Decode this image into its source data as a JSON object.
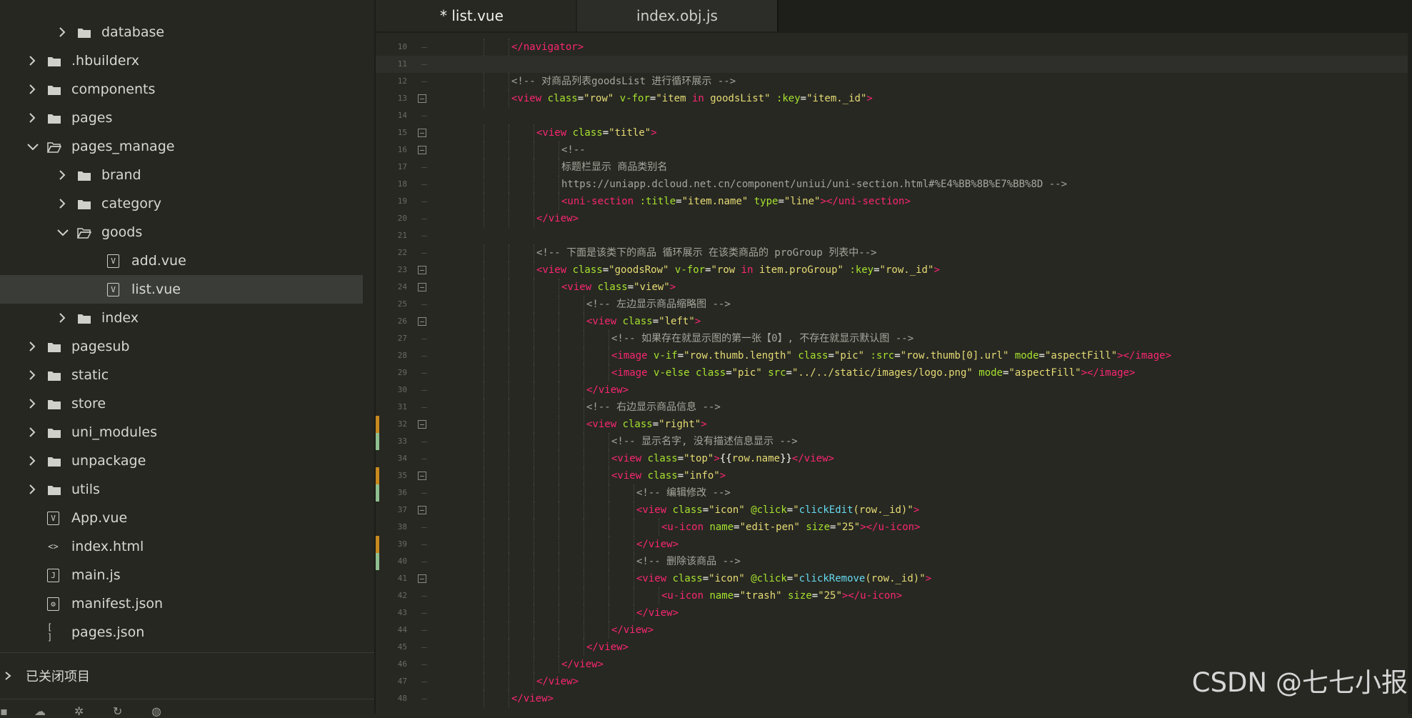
{
  "sidebar": {
    "items": [
      {
        "label": "database",
        "kind": "folder",
        "state": "collapsed",
        "depth": 1
      },
      {
        "label": ".hbuilderx",
        "kind": "folder",
        "state": "collapsed",
        "depth": 0
      },
      {
        "label": "components",
        "kind": "folder",
        "state": "collapsed",
        "depth": 0
      },
      {
        "label": "pages",
        "kind": "folder",
        "state": "collapsed",
        "depth": 0
      },
      {
        "label": "pages_manage",
        "kind": "folder",
        "state": "expanded",
        "depth": 0
      },
      {
        "label": "brand",
        "kind": "folder",
        "state": "collapsed",
        "depth": 1
      },
      {
        "label": "category",
        "kind": "folder",
        "state": "collapsed",
        "depth": 1
      },
      {
        "label": "goods",
        "kind": "folder",
        "state": "expanded",
        "depth": 1
      },
      {
        "label": "add.vue",
        "kind": "vue",
        "depth": 2
      },
      {
        "label": "list.vue",
        "kind": "vue",
        "depth": 2,
        "selected": true
      },
      {
        "label": "index",
        "kind": "folder",
        "state": "collapsed",
        "depth": 1
      },
      {
        "label": "pagesub",
        "kind": "folder",
        "state": "collapsed",
        "depth": 0
      },
      {
        "label": "static",
        "kind": "folder",
        "state": "collapsed",
        "depth": 0
      },
      {
        "label": "store",
        "kind": "folder",
        "state": "collapsed",
        "depth": 0
      },
      {
        "label": "uni_modules",
        "kind": "folder",
        "state": "collapsed",
        "depth": 0
      },
      {
        "label": "unpackage",
        "kind": "folder",
        "state": "collapsed",
        "depth": 0
      },
      {
        "label": "utils",
        "kind": "folder",
        "state": "collapsed",
        "depth": 0
      },
      {
        "label": "App.vue",
        "kind": "vue",
        "depth": 0
      },
      {
        "label": "index.html",
        "kind": "html",
        "depth": 0
      },
      {
        "label": "main.js",
        "kind": "js",
        "depth": 0
      },
      {
        "label": "manifest.json",
        "kind": "manifest",
        "depth": 0
      },
      {
        "label": "pages.json",
        "kind": "json",
        "depth": 0
      }
    ],
    "closed_projects": "已关闭项目"
  },
  "tabs": [
    {
      "label": "* list.vue",
      "active": true
    },
    {
      "label": "index.obj.js",
      "active": false
    }
  ],
  "editor": {
    "lines": [
      {
        "n": "10",
        "indent": 2,
        "fold": "",
        "parts": [
          [
            "tag",
            "</navigator>"
          ]
        ]
      },
      {
        "n": "11",
        "indent": 0,
        "fold": "",
        "current": true,
        "parts": []
      },
      {
        "n": "12",
        "indent": 2,
        "fold": "",
        "parts": [
          [
            "cmt",
            "<!-- 对商品列表goodsList 进行循环展示 -->"
          ]
        ]
      },
      {
        "n": "13",
        "indent": 2,
        "fold": "box",
        "parts": [
          [
            "tag",
            "<view "
          ],
          [
            "attr",
            "class"
          ],
          [
            "pl",
            "="
          ],
          [
            "str",
            "\"row\""
          ],
          [
            "pl",
            " "
          ],
          [
            "attr",
            "v-for"
          ],
          [
            "pl",
            "="
          ],
          [
            "str",
            "\"item "
          ],
          [
            "tag",
            "in"
          ],
          [
            "str",
            " goodsList\""
          ],
          [
            "pl",
            " "
          ],
          [
            "attr",
            ":key"
          ],
          [
            "pl",
            "="
          ],
          [
            "str",
            "\"item._id\""
          ],
          [
            "tag",
            ">"
          ]
        ]
      },
      {
        "n": "14",
        "indent": 0,
        "fold": "",
        "parts": []
      },
      {
        "n": "15",
        "indent": 3,
        "fold": "box",
        "parts": [
          [
            "tag",
            "<view "
          ],
          [
            "attr",
            "class"
          ],
          [
            "pl",
            "="
          ],
          [
            "str",
            "\"title\""
          ],
          [
            "tag",
            ">"
          ]
        ]
      },
      {
        "n": "16",
        "indent": 4,
        "fold": "box",
        "parts": [
          [
            "cmt",
            "<!--"
          ]
        ]
      },
      {
        "n": "17",
        "indent": 4,
        "fold": "",
        "parts": [
          [
            "cmt",
            "标题栏显示 商品类别名"
          ]
        ]
      },
      {
        "n": "18",
        "indent": 4,
        "fold": "",
        "parts": [
          [
            "cmt",
            "https://uniapp.dcloud.net.cn/component/uniui/uni-section.html#%E4%BB%8B%E7%BB%8D -->"
          ]
        ]
      },
      {
        "n": "19",
        "indent": 4,
        "fold": "",
        "parts": [
          [
            "tag",
            "<uni-section "
          ],
          [
            "attr",
            ":title"
          ],
          [
            "pl",
            "="
          ],
          [
            "str",
            "\"item.name\""
          ],
          [
            "pl",
            " "
          ],
          [
            "attr",
            "type"
          ],
          [
            "pl",
            "="
          ],
          [
            "str",
            "\"line\""
          ],
          [
            "tag",
            "></uni-section>"
          ]
        ]
      },
      {
        "n": "20",
        "indent": 3,
        "fold": "",
        "parts": [
          [
            "tag",
            "</view>"
          ]
        ]
      },
      {
        "n": "21",
        "indent": 0,
        "fold": "",
        "parts": []
      },
      {
        "n": "22",
        "indent": 3,
        "fold": "",
        "parts": [
          [
            "cmt",
            "<!-- 下面是该类下的商品 循环展示 在该类商品的 proGroup 列表中-->"
          ]
        ]
      },
      {
        "n": "23",
        "indent": 3,
        "fold": "box",
        "parts": [
          [
            "tag",
            "<view "
          ],
          [
            "attr",
            "class"
          ],
          [
            "pl",
            "="
          ],
          [
            "str",
            "\"goodsRow\""
          ],
          [
            "pl",
            " "
          ],
          [
            "attr",
            "v-for"
          ],
          [
            "pl",
            "="
          ],
          [
            "str",
            "\"row "
          ],
          [
            "tag",
            "in"
          ],
          [
            "str",
            " item.proGroup\""
          ],
          [
            "pl",
            " "
          ],
          [
            "attr",
            ":key"
          ],
          [
            "pl",
            "="
          ],
          [
            "str",
            "\"row._id\""
          ],
          [
            "tag",
            ">"
          ]
        ]
      },
      {
        "n": "24",
        "indent": 4,
        "fold": "box",
        "parts": [
          [
            "tag",
            "<view "
          ],
          [
            "attr",
            "class"
          ],
          [
            "pl",
            "="
          ],
          [
            "str",
            "\"view\""
          ],
          [
            "tag",
            ">"
          ]
        ]
      },
      {
        "n": "25",
        "indent": 5,
        "fold": "",
        "parts": [
          [
            "cmt",
            "<!-- 左边显示商品缩略图 -->"
          ]
        ]
      },
      {
        "n": "26",
        "indent": 5,
        "fold": "box",
        "parts": [
          [
            "tag",
            "<view "
          ],
          [
            "attr",
            "class"
          ],
          [
            "pl",
            "="
          ],
          [
            "str",
            "\"left\""
          ],
          [
            "tag",
            ">"
          ]
        ]
      },
      {
        "n": "27",
        "indent": 6,
        "fold": "",
        "parts": [
          [
            "cmt",
            "<!-- 如果存在就显示图的第一张【0】, 不存在就显示默认图 -->"
          ]
        ]
      },
      {
        "n": "28",
        "indent": 6,
        "fold": "",
        "parts": [
          [
            "tag",
            "<image "
          ],
          [
            "attr",
            "v-if"
          ],
          [
            "pl",
            "="
          ],
          [
            "str",
            "\"row.thumb.length\""
          ],
          [
            "pl",
            " "
          ],
          [
            "attr",
            "class"
          ],
          [
            "pl",
            "="
          ],
          [
            "str",
            "\"pic\""
          ],
          [
            "pl",
            " "
          ],
          [
            "attr",
            ":src"
          ],
          [
            "pl",
            "="
          ],
          [
            "str",
            "\"row.thumb[0].url\""
          ],
          [
            "pl",
            " "
          ],
          [
            "attr",
            "mode"
          ],
          [
            "pl",
            "="
          ],
          [
            "str",
            "\"aspectFill\""
          ],
          [
            "tag",
            "></image>"
          ]
        ]
      },
      {
        "n": "29",
        "indent": 6,
        "fold": "",
        "parts": [
          [
            "tag",
            "<image "
          ],
          [
            "attr",
            "v-else "
          ],
          [
            "attr",
            "class"
          ],
          [
            "pl",
            "="
          ],
          [
            "str",
            "\"pic\""
          ],
          [
            "pl",
            " "
          ],
          [
            "attr",
            "src"
          ],
          [
            "pl",
            "="
          ],
          [
            "str",
            "\"../../static/images/logo.png\""
          ],
          [
            "pl",
            " "
          ],
          [
            "attr",
            "mode"
          ],
          [
            "pl",
            "="
          ],
          [
            "str",
            "\"aspectFill\""
          ],
          [
            "tag",
            "></image>"
          ]
        ]
      },
      {
        "n": "30",
        "indent": 5,
        "fold": "",
        "parts": [
          [
            "tag",
            "</view>"
          ]
        ]
      },
      {
        "n": "31",
        "indent": 5,
        "fold": "",
        "parts": [
          [
            "cmt",
            "<!-- 右边显示商品信息 -->"
          ]
        ]
      },
      {
        "n": "32",
        "indent": 5,
        "fold": "box",
        "git": "#c8891e",
        "parts": [
          [
            "tag",
            "<view "
          ],
          [
            "attr",
            "class"
          ],
          [
            "pl",
            "="
          ],
          [
            "str",
            "\"right\""
          ],
          [
            "tag",
            ">"
          ]
        ]
      },
      {
        "n": "33",
        "indent": 6,
        "fold": "",
        "git": "#8fbf8f",
        "parts": [
          [
            "cmt",
            "<!-- 显示名字, 没有描述信息显示 -->"
          ]
        ]
      },
      {
        "n": "34",
        "indent": 6,
        "fold": "",
        "parts": [
          [
            "tag",
            "<view "
          ],
          [
            "attr",
            "class"
          ],
          [
            "pl",
            "="
          ],
          [
            "str",
            "\"top\""
          ],
          [
            "tag",
            ">"
          ],
          [
            "pl",
            "{{"
          ],
          [
            "str",
            "row.name"
          ],
          [
            "pl",
            "}}"
          ],
          [
            "tag",
            "</view>"
          ]
        ]
      },
      {
        "n": "35",
        "indent": 6,
        "fold": "box",
        "git": "#c8891e",
        "parts": [
          [
            "tag",
            "<view "
          ],
          [
            "attr",
            "class"
          ],
          [
            "pl",
            "="
          ],
          [
            "str",
            "\"info\""
          ],
          [
            "tag",
            ">"
          ]
        ]
      },
      {
        "n": "36",
        "indent": 7,
        "fold": "",
        "git": "#8fbf8f",
        "parts": [
          [
            "cmt",
            "<!-- 编辑修改 -->"
          ]
        ]
      },
      {
        "n": "37",
        "indent": 7,
        "fold": "box",
        "parts": [
          [
            "tag",
            "<view "
          ],
          [
            "attr",
            "class"
          ],
          [
            "pl",
            "="
          ],
          [
            "str",
            "\"icon\""
          ],
          [
            "pl",
            " "
          ],
          [
            "attr",
            "@click"
          ],
          [
            "pl",
            "="
          ],
          [
            "str",
            "\""
          ],
          [
            "fn",
            "clickEdit"
          ],
          [
            "str",
            "(row._id)\""
          ],
          [
            "tag",
            ">"
          ]
        ]
      },
      {
        "n": "38",
        "indent": 8,
        "fold": "",
        "parts": [
          [
            "tag",
            "<u-icon "
          ],
          [
            "attr",
            "name"
          ],
          [
            "pl",
            "="
          ],
          [
            "str",
            "\"edit-pen\""
          ],
          [
            "pl",
            " "
          ],
          [
            "attr",
            "size"
          ],
          [
            "pl",
            "="
          ],
          [
            "str",
            "\"25\""
          ],
          [
            "tag",
            "></u-icon>"
          ]
        ]
      },
      {
        "n": "39",
        "indent": 7,
        "fold": "",
        "git": "#c8891e",
        "parts": [
          [
            "tag",
            "</view>"
          ]
        ]
      },
      {
        "n": "40",
        "indent": 7,
        "fold": "",
        "git": "#8fbf8f",
        "parts": [
          [
            "cmt",
            "<!-- 删除该商品 -->"
          ]
        ]
      },
      {
        "n": "41",
        "indent": 7,
        "fold": "box",
        "parts": [
          [
            "tag",
            "<view "
          ],
          [
            "attr",
            "class"
          ],
          [
            "pl",
            "="
          ],
          [
            "str",
            "\"icon\""
          ],
          [
            "pl",
            " "
          ],
          [
            "attr",
            "@click"
          ],
          [
            "pl",
            "="
          ],
          [
            "str",
            "\""
          ],
          [
            "fn",
            "clickRemove"
          ],
          [
            "str",
            "(row._id)\""
          ],
          [
            "tag",
            ">"
          ]
        ]
      },
      {
        "n": "42",
        "indent": 8,
        "fold": "",
        "parts": [
          [
            "tag",
            "<u-icon "
          ],
          [
            "attr",
            "name"
          ],
          [
            "pl",
            "="
          ],
          [
            "str",
            "\"trash\""
          ],
          [
            "pl",
            " "
          ],
          [
            "attr",
            "size"
          ],
          [
            "pl",
            "="
          ],
          [
            "str",
            "\"25\""
          ],
          [
            "tag",
            "></u-icon>"
          ]
        ]
      },
      {
        "n": "43",
        "indent": 7,
        "fold": "",
        "parts": [
          [
            "tag",
            "</view>"
          ]
        ]
      },
      {
        "n": "44",
        "indent": 6,
        "fold": "",
        "parts": [
          [
            "tag",
            "</view>"
          ]
        ]
      },
      {
        "n": "45",
        "indent": 5,
        "fold": "",
        "parts": [
          [
            "tag",
            "</view>"
          ]
        ]
      },
      {
        "n": "46",
        "indent": 4,
        "fold": "",
        "parts": [
          [
            "tag",
            "</view>"
          ]
        ]
      },
      {
        "n": "47",
        "indent": 3,
        "fold": "",
        "parts": [
          [
            "tag",
            "</view>"
          ]
        ]
      },
      {
        "n": "48",
        "indent": 2,
        "fold": "",
        "parts": [
          [
            "tag",
            "</view>"
          ]
        ]
      }
    ]
  },
  "watermark": "CSDN @七七小报"
}
